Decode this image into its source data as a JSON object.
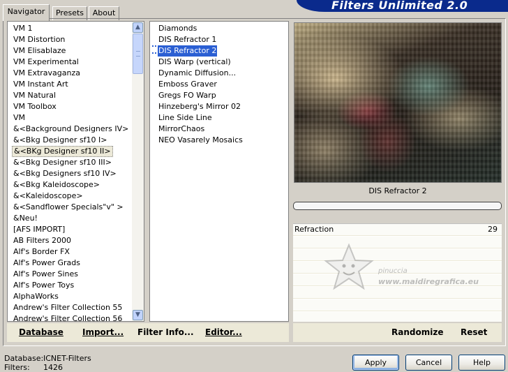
{
  "tabs": [
    {
      "label": "Navigator",
      "active": true
    },
    {
      "label": "Presets",
      "active": false
    },
    {
      "label": "About",
      "active": false
    }
  ],
  "banner": {
    "title": "Filters Unlimited 2.0",
    "color": "#0a2a8c"
  },
  "categories": {
    "items": [
      "VM 1",
      "VM Distortion",
      "VM Elisablaze",
      "VM Experimental",
      "VM Extravaganza",
      "VM Instant Art",
      "VM Natural",
      "VM Toolbox",
      "VM",
      "&<Background Designers IV>",
      "&<Bkg Designer sf10 I>",
      "&<BKg Designer sf10 II>",
      "&<Bkg Designer sf10 III>",
      "&<Bkg Designers sf10 IV>",
      "&<Bkg Kaleidoscope>",
      "&<Kaleidoscope>",
      "&<Sandflower Specials\"v\" >",
      "&Neu!",
      "[AFS IMPORT]",
      "AB Filters 2000",
      "Alf's Border FX",
      "Alf's Power Grads",
      "Alf's Power Sines",
      "Alf's Power Toys",
      "AlphaWorks",
      "Andrew's Filter Collection 55",
      "Andrew's Filter Collection 56"
    ],
    "selected_index": 11
  },
  "filters": {
    "items": [
      "Diamonds",
      "DIS Refractor 1",
      "DIS Refractor 2",
      "DIS Warp (vertical)",
      "Dynamic Diffusion...",
      "Emboss Graver",
      "Gregs FO Warp",
      "Hinzeberg's Mirror 02",
      "Line Side Line",
      "MirrorChaos",
      "NEO Vasarely Mosaics"
    ],
    "selected_index": 2
  },
  "toolbar_left": {
    "database": "Database",
    "import": "Import...",
    "filter_info": "Filter Info...",
    "editor": "Editor..."
  },
  "preview": {
    "caption": "DIS Refractor 2",
    "progress_fraction": 0
  },
  "params": [
    {
      "label": "Refraction",
      "value": "29"
    }
  ],
  "watermark": {
    "line1": "pinuccia",
    "line2": "www.maidiregrafica.eu"
  },
  "toolbar_right": {
    "randomize": "Randomize",
    "reset": "Reset"
  },
  "status": {
    "database_label": "Database:",
    "database_value": "ICNET-Filters",
    "filters_label": "Filters:",
    "filters_value": "1426"
  },
  "dialog": {
    "apply": "Apply",
    "cancel": "Cancel",
    "help": "Help"
  }
}
